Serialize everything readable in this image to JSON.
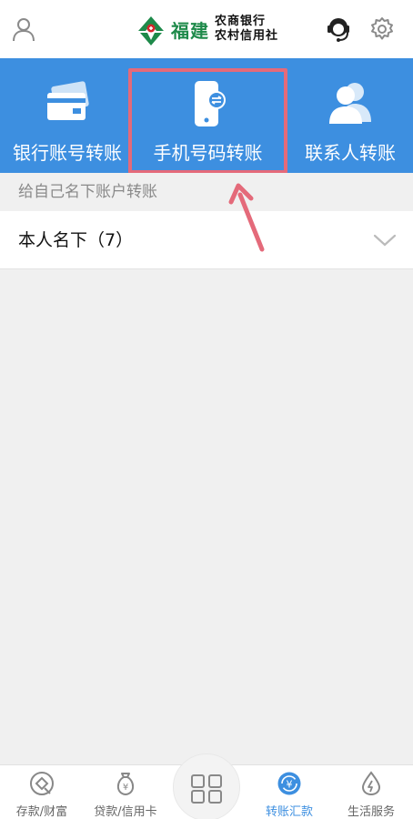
{
  "header": {
    "user_icon": "user-icon",
    "logo_main": "福建",
    "logo_line1": "农商银行",
    "logo_line2": "农村信用社",
    "service_icon": "customer-service-icon",
    "settings_icon": "gear-icon"
  },
  "transfer_options": [
    {
      "label": "银行账号转账",
      "icon": "bank-card-icon"
    },
    {
      "label": "手机号码转账",
      "icon": "phone-transfer-icon"
    },
    {
      "label": "联系人转账",
      "icon": "contacts-icon"
    }
  ],
  "section": {
    "title": "给自己名下账户转账",
    "owner_label": "本人名下（7）"
  },
  "tabbar": [
    {
      "label": "存款/财富",
      "icon": "deposit-icon"
    },
    {
      "label": "贷款/信用卡",
      "icon": "loan-icon"
    },
    {
      "label": "",
      "icon": "grid-menu-icon"
    },
    {
      "label": "转账汇款",
      "icon": "transfer-icon",
      "active": true
    },
    {
      "label": "生活服务",
      "icon": "life-service-icon"
    }
  ],
  "colors": {
    "primary": "#3d8fe0",
    "highlight": "#e46a7a",
    "logo_green": "#1e8a4a"
  }
}
